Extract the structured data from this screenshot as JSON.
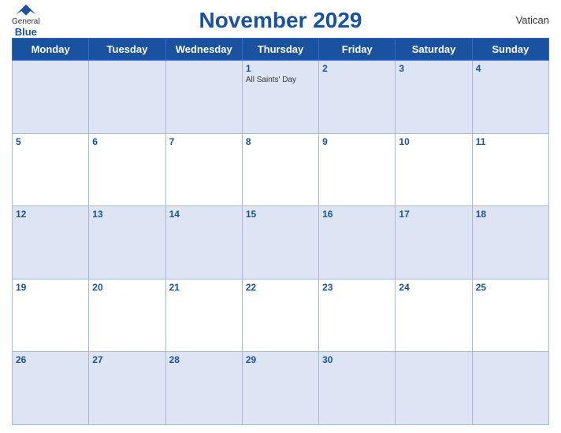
{
  "header": {
    "logo_general": "General",
    "logo_blue": "Blue",
    "title": "November 2029",
    "region": "Vatican"
  },
  "weekdays": [
    "Monday",
    "Tuesday",
    "Wednesday",
    "Thursday",
    "Friday",
    "Saturday",
    "Sunday"
  ],
  "weeks": [
    [
      {
        "day": "",
        "holiday": ""
      },
      {
        "day": "",
        "holiday": ""
      },
      {
        "day": "",
        "holiday": ""
      },
      {
        "day": "1",
        "holiday": "All Saints' Day"
      },
      {
        "day": "2",
        "holiday": ""
      },
      {
        "day": "3",
        "holiday": ""
      },
      {
        "day": "4",
        "holiday": ""
      }
    ],
    [
      {
        "day": "5",
        "holiday": ""
      },
      {
        "day": "6",
        "holiday": ""
      },
      {
        "day": "7",
        "holiday": ""
      },
      {
        "day": "8",
        "holiday": ""
      },
      {
        "day": "9",
        "holiday": ""
      },
      {
        "day": "10",
        "holiday": ""
      },
      {
        "day": "11",
        "holiday": ""
      }
    ],
    [
      {
        "day": "12",
        "holiday": ""
      },
      {
        "day": "13",
        "holiday": ""
      },
      {
        "day": "14",
        "holiday": ""
      },
      {
        "day": "15",
        "holiday": ""
      },
      {
        "day": "16",
        "holiday": ""
      },
      {
        "day": "17",
        "holiday": ""
      },
      {
        "day": "18",
        "holiday": ""
      }
    ],
    [
      {
        "day": "19",
        "holiday": ""
      },
      {
        "day": "20",
        "holiday": ""
      },
      {
        "day": "21",
        "holiday": ""
      },
      {
        "day": "22",
        "holiday": ""
      },
      {
        "day": "23",
        "holiday": ""
      },
      {
        "day": "24",
        "holiday": ""
      },
      {
        "day": "25",
        "holiday": ""
      }
    ],
    [
      {
        "day": "26",
        "holiday": ""
      },
      {
        "day": "27",
        "holiday": ""
      },
      {
        "day": "28",
        "holiday": ""
      },
      {
        "day": "29",
        "holiday": ""
      },
      {
        "day": "30",
        "holiday": ""
      },
      {
        "day": "",
        "holiday": ""
      },
      {
        "day": "",
        "holiday": ""
      }
    ]
  ]
}
